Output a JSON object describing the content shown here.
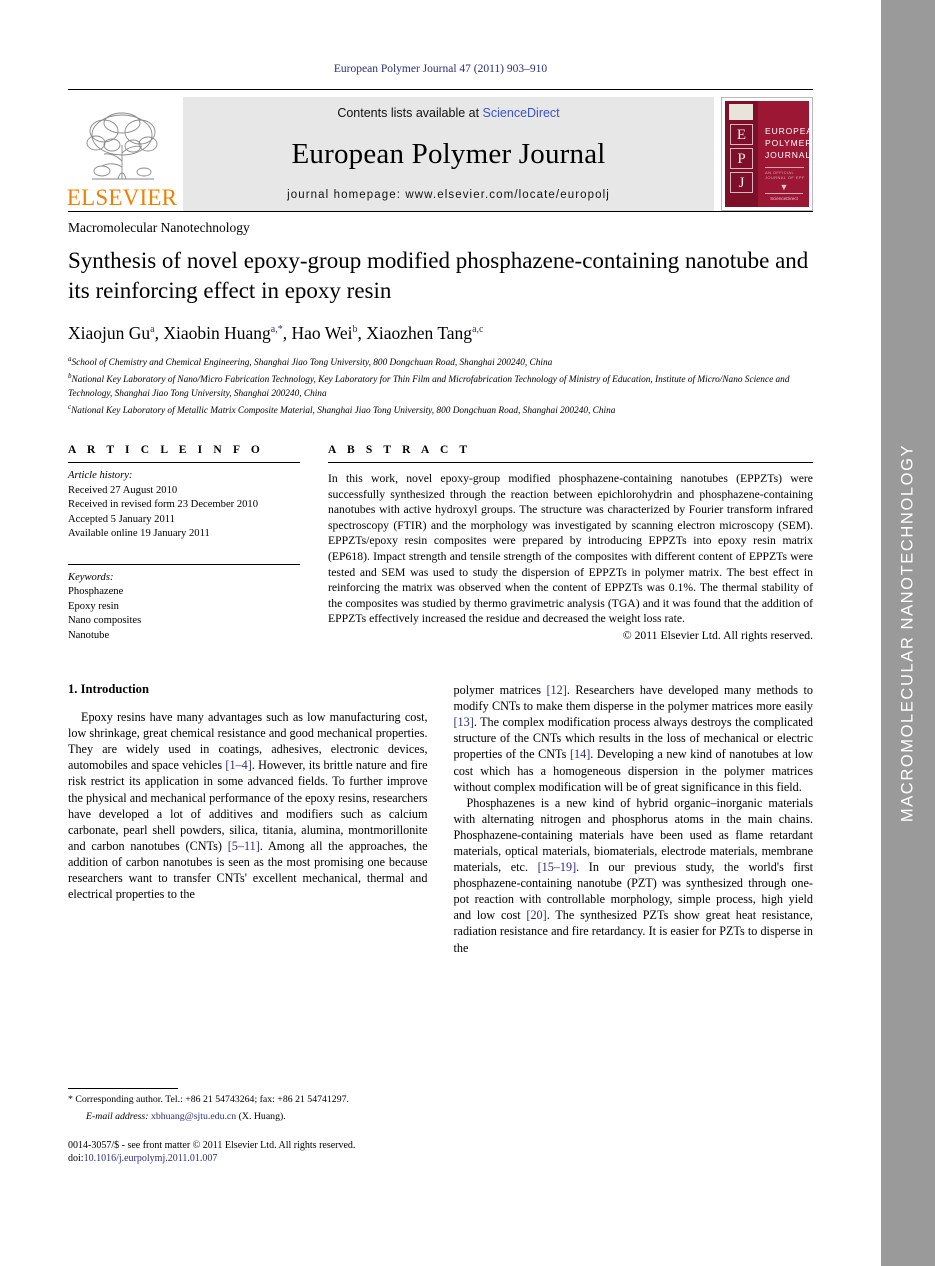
{
  "running_head": "European Polymer Journal 47 (2011) 903–910",
  "masthead": {
    "contents_prefix": "Contents lists available at ",
    "sciencedirect": "ScienceDirect",
    "journal_name": "European Polymer Journal",
    "homepage": "journal homepage: www.elsevier.com/locate/europolj",
    "elsevier_wordmark": "ELSEVIER",
    "elsevier_color": "#f08000",
    "sciencedirect_color": "#3b53c6",
    "cover": {
      "letters": [
        "E",
        "P",
        "J"
      ],
      "title_lines": [
        "EUROPEAN",
        "POLYMER",
        "JOURNAL"
      ],
      "subtext": "AN OFFICIAL JOURNAL OF EPF",
      "footer": "ScienceDirect",
      "bg_color": "#9c1733"
    }
  },
  "section_label": "Macromolecular Nanotechnology",
  "side_band": {
    "label": "MACROMOLECULAR NANOTECHNOLOGY",
    "bg_color": "#9a9a9a",
    "text_color": "#ffffff"
  },
  "article": {
    "title": "Synthesis of novel epoxy-group modified phosphazene-containing nanotube and its reinforcing effect in epoxy resin",
    "authors": [
      {
        "name": "Xiaojun Gu",
        "sup": "a",
        "sep": ", "
      },
      {
        "name": "Xiaobin Huang",
        "sup": "a,*",
        "sep": ", "
      },
      {
        "name": "Hao Wei",
        "sup": "b",
        "sep": ", "
      },
      {
        "name": "Xiaozhen Tang",
        "sup": "a,c",
        "sep": ""
      }
    ],
    "affiliations": [
      {
        "mark": "a",
        "text": "School of Chemistry and Chemical Engineering, Shanghai Jiao Tong University, 800 Dongchuan Road, Shanghai 200240, China"
      },
      {
        "mark": "b",
        "text": "National Key Laboratory of Nano/Micro Fabrication Technology, Key Laboratory for Thin Film and Microfabrication Technology of Ministry of Education, Institute of Micro/Nano Science and Technology, Shanghai Jiao Tong University, Shanghai 200240, China"
      },
      {
        "mark": "c",
        "text": "National Key Laboratory of Metallic Matrix Composite Material, Shanghai Jiao Tong University, 800 Dongchuan Road, Shanghai 200240, China"
      }
    ]
  },
  "article_info": {
    "heading": "A R T I C L E   I N F O",
    "history_label": "Article history:",
    "history": [
      "Received 27 August 2010",
      "Received in revised form 23 December 2010",
      "Accepted 5 January 2011",
      "Available online 19 January 2011"
    ],
    "keywords_label": "Keywords:",
    "keywords": [
      "Phosphazene",
      "Epoxy resin",
      "Nano composites",
      "Nanotube"
    ]
  },
  "abstract": {
    "heading": "A B S T R A C T",
    "text": "In this work, novel epoxy-group modified phosphazene-containing nanotubes (EPPZTs) were successfully synthesized through the reaction between epichlorohydrin and phosphazene-containing nanotubes with active hydroxyl groups. The structure was characterized by Fourier transform infrared spectroscopy (FTIR) and the morphology was investigated by scanning electron microscopy (SEM). EPPZTs/epoxy resin composites were prepared by introducing EPPZTs into epoxy resin matrix (EP618). Impact strength and tensile strength of the composites with different content of EPPZTs were tested and SEM was used to study the dispersion of EPPZTs in polymer matrix. The best effect in reinforcing the matrix was observed when the content of EPPZTs was 0.1%. The thermal stability of the composites was studied by thermo gravimetric analysis (TGA) and it was found that the addition of EPPZTs effectively increased the residue and decreased the weight loss rate.",
    "copyright": "© 2011 Elsevier Ltd. All rights reserved."
  },
  "body": {
    "intro_heading": "1. Introduction",
    "left_paragraphs": [
      "Epoxy resins have many advantages such as low manufacturing cost, low shrinkage, great chemical resistance and good mechanical properties. They are widely used in coatings, adhesives, electronic devices, automobiles and space vehicles [1–4]. However, its brittle nature and fire risk restrict its application in some advanced fields. To further improve the physical and mechanical performance of the epoxy resins, researchers have developed a lot of additives and modifiers such as calcium carbonate, pearl shell powders, silica, titania, alumina, montmorillonite and carbon nanotubes (CNTs) [5–11]. Among all the approaches, the addition of carbon nanotubes is seen as the most promising one because researchers want to transfer CNTs' excellent mechanical, thermal and electrical properties to the"
    ],
    "right_paragraphs": [
      "polymer matrices [12]. Researchers have developed many methods to modify CNTs to make them disperse in the polymer matrices more easily [13]. The complex modification process always destroys the complicated structure of the CNTs which results in the loss of mechanical or electric properties of the CNTs [14]. Developing a new kind of nanotubes at low cost which has a homogeneous dispersion in the polymer matrices without complex modification will be of great significance in this field.",
      "Phosphazenes is a new kind of hybrid organic–inorganic materials with alternating nitrogen and phosphorus atoms in the main chains. Phosphazene-containing materials have been used as flame retardant materials, optical materials, biomaterials, electrode materials, membrane materials, etc. [15–19]. In our previous study, the world's first phosphazene-containing nanotube (PZT) was synthesized through one-pot reaction with controllable morphology, simple process, high yield and low cost [20]. The synthesized PZTs show great heat resistance, radiation resistance and fire retardancy. It is easier for PZTs to disperse in the"
    ]
  },
  "footnotes": {
    "corresponding_mark": "*",
    "corresponding": "Corresponding author. Tel.: +86 21 54743264; fax: +86 21 54741297.",
    "email_label": "E-mail address:",
    "email": "xbhuang@sjtu.edu.cn",
    "email_owner": "(X. Huang).",
    "issn_line": "0014-3057/$ - see front matter © 2011 Elsevier Ltd. All rights reserved.",
    "doi_label": "doi:",
    "doi": "10.1016/j.eurpolymj.2011.01.007"
  }
}
